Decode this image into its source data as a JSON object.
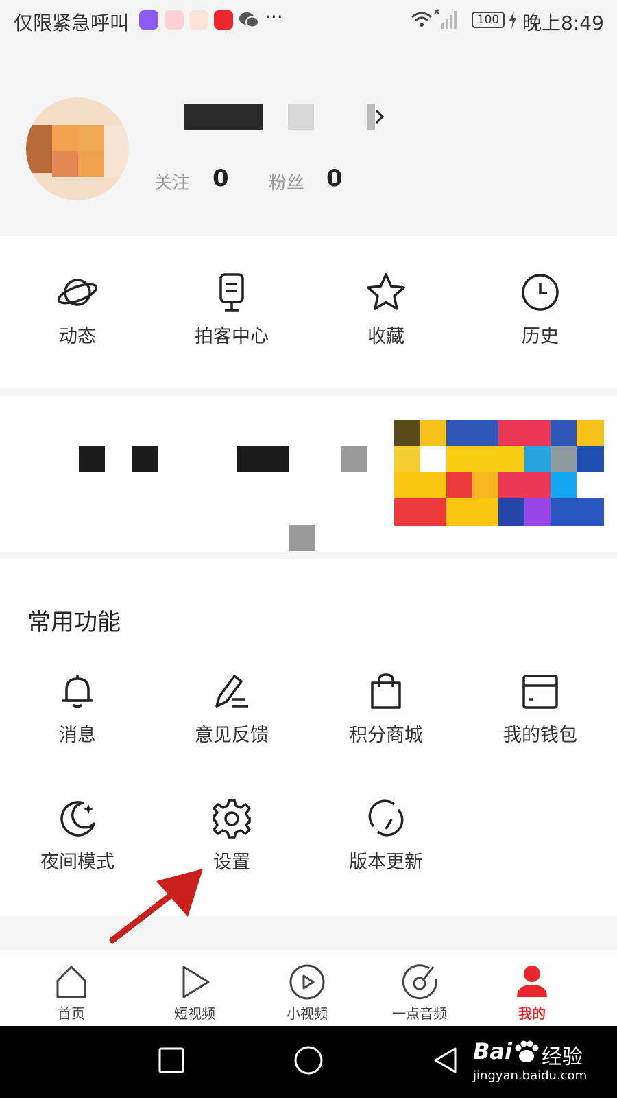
{
  "status_bar": {
    "carrier_text": "仅限紧急呼叫",
    "more": "···",
    "battery": "100",
    "time": "晚上8:49"
  },
  "profile": {
    "follow_label": "关注",
    "follow_count": "0",
    "fans_label": "粉丝",
    "fans_count": "0"
  },
  "quick_nav": [
    {
      "label": "动态",
      "icon": "planet-icon"
    },
    {
      "label": "拍客中心",
      "icon": "microphone-icon"
    },
    {
      "label": "收藏",
      "icon": "star-icon"
    },
    {
      "label": "历史",
      "icon": "clock-icon"
    }
  ],
  "common_functions": {
    "title": "常用功能",
    "items": [
      {
        "label": "消息",
        "icon": "bell-icon"
      },
      {
        "label": "意见反馈",
        "icon": "pen-icon"
      },
      {
        "label": "积分商城",
        "icon": "shopping-bag-icon"
      },
      {
        "label": "我的钱包",
        "icon": "wallet-icon"
      },
      {
        "label": "夜间模式",
        "icon": "moon-icon"
      },
      {
        "label": "设置",
        "icon": "gear-icon"
      },
      {
        "label": "版本更新",
        "icon": "refresh-icon"
      }
    ]
  },
  "tab_bar": [
    {
      "label": "首页",
      "icon": "home-icon"
    },
    {
      "label": "短视频",
      "icon": "play-icon"
    },
    {
      "label": "小视频",
      "icon": "play-circle-icon"
    },
    {
      "label": "一点音频",
      "icon": "audio-disc-icon"
    },
    {
      "label": "我的",
      "icon": "person-icon",
      "active": true
    }
  ],
  "watermark": {
    "brand": "Bai",
    "brand_cn": "经验",
    "url": "jingyan.baidu.com"
  },
  "colors": {
    "accent": "#e8282e",
    "arrow": "#c8201c",
    "background": "#f5f5f5"
  }
}
